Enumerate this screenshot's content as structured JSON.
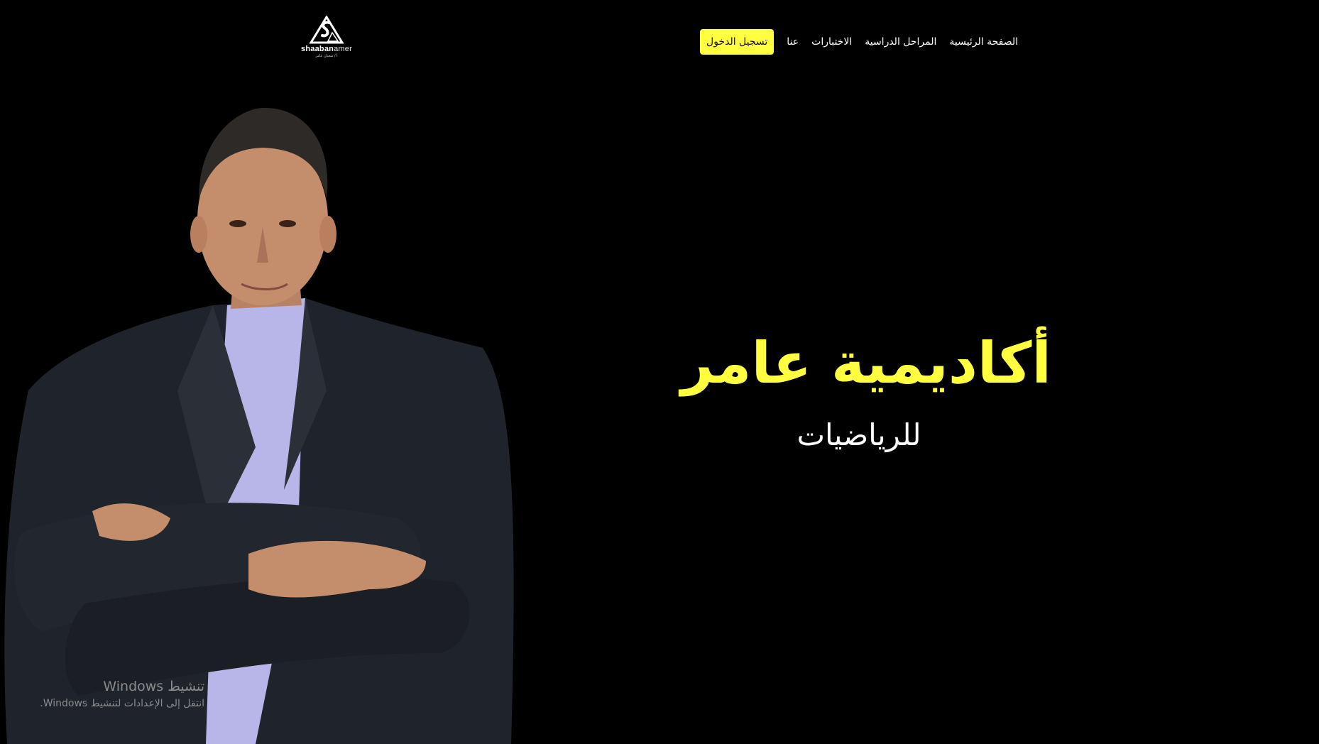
{
  "brand": {
    "name_bold": "shaaban",
    "name_light": "amer",
    "tagline": "أ / شعبان عامر"
  },
  "nav": {
    "items": [
      {
        "label": "الصفحة الرئيسية"
      },
      {
        "label": "المراحل الدراسية"
      },
      {
        "label": "الاختبارات"
      },
      {
        "label": "عنا"
      }
    ],
    "login_label": "تسجيل الدخول"
  },
  "hero": {
    "title": "أكاديمية عامر",
    "subtitle": "للرياضيات"
  },
  "watermark": {
    "title": "تنشيط Windows",
    "subtitle": "انتقل إلى الإعدادات لتنشيط Windows."
  },
  "colors": {
    "background": "#000000",
    "accent": "#ffff3f",
    "text": "#ffffff"
  }
}
